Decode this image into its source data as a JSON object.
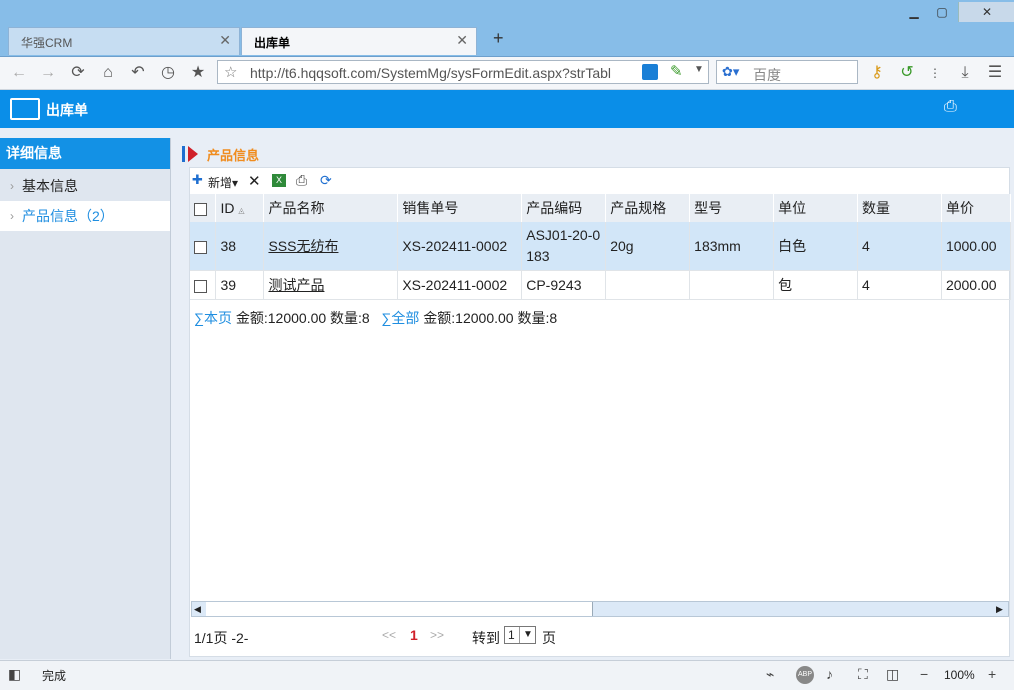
{
  "browser": {
    "tabs": [
      {
        "label": "华强CRM"
      },
      {
        "label": "出库单"
      }
    ],
    "new_tab_glyph": "+",
    "url": "http://t6.hqqsoft.com/SystemMg/sysFormEdit.aspx?strTabl",
    "search_placeholder": "百度",
    "status_text": "完成",
    "zoom": "100%"
  },
  "app": {
    "title": "出库单"
  },
  "sidebar": {
    "header": "详细信息",
    "items": [
      {
        "label": "基本信息"
      },
      {
        "label": "产品信息（2）"
      }
    ]
  },
  "section": {
    "title": "产品信息"
  },
  "toolbar": {
    "new_label": "新增"
  },
  "grid": {
    "columns": [
      "ID",
      "产品名称",
      "销售单号",
      "产品编码",
      "产品规格",
      "型号",
      "单位",
      "数量",
      "单价"
    ],
    "rows": [
      {
        "id": "38",
        "name": "SSS无纺布",
        "order": "XS-202411-0002",
        "code": "ASJ01-20-0183",
        "spec": "20g",
        "model": "183mm",
        "unit": "白色",
        "qty": "4",
        "price": "1000.00"
      },
      {
        "id": "39",
        "name": "测试产品",
        "order": "XS-202411-0002",
        "code": "CP-9243",
        "spec": "",
        "model": "",
        "unit": "包",
        "qty": "4",
        "price": "2000.00"
      }
    ]
  },
  "summary": {
    "page_label": "∑本页",
    "page_text": "金额:12000.00 数量:8",
    "all_label": "∑全部",
    "all_text": "金额:12000.00 数量:8"
  },
  "pager": {
    "info": "1/1页 -2-",
    "prev": "<<",
    "current": "1",
    "next": ">>",
    "goto_label": "转到",
    "goto_value": "1",
    "page_suffix": "页"
  },
  "colors": {
    "accent": "#0a8ee8",
    "section_title": "#f08c1e",
    "selected_row": "#d2e6f8"
  }
}
